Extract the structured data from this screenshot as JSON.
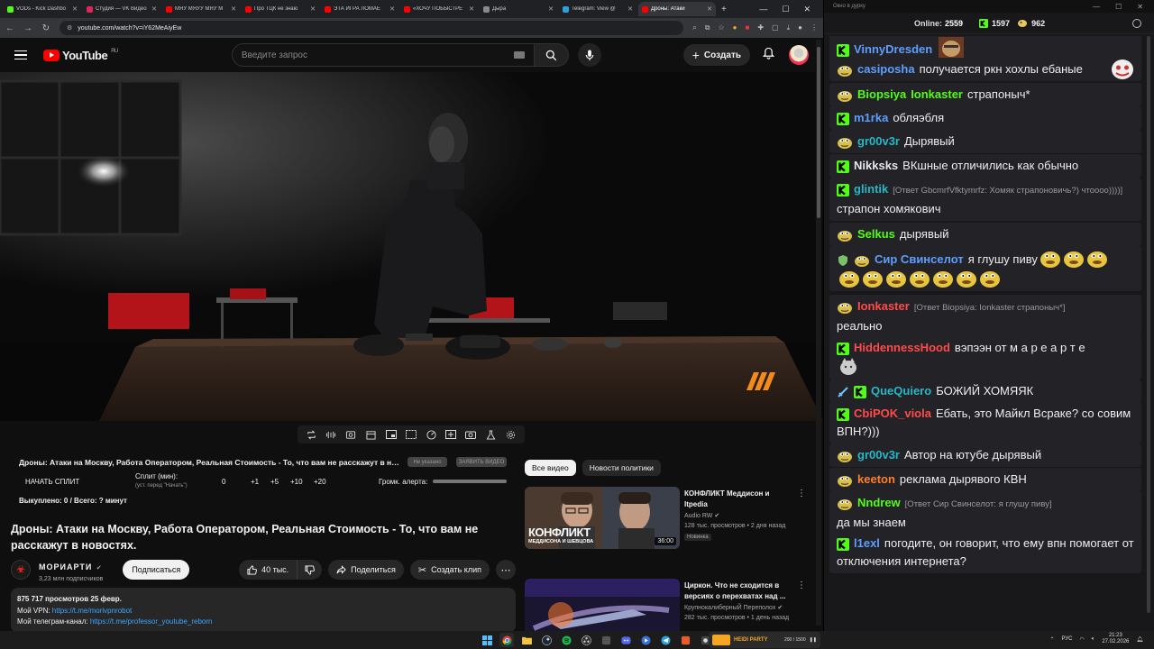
{
  "browser": {
    "tabs": [
      {
        "label": "VODs - Kick Dashbo",
        "color": "#53fc18"
      },
      {
        "label": "Студия — VK Видео",
        "color": "#e0245e"
      },
      {
        "label": "МЯУ МЯУУ МЯУ М",
        "color": "#ff0000"
      },
      {
        "label": "Про ТЦК не знаю",
        "color": "#ff0000"
      },
      {
        "label": "ЭТА ИГРА ЛОМАЕ",
        "color": "#ff0000"
      },
      {
        "label": "«ХОЧУ ПОБЫСТРЕ",
        "color": "#ff0000"
      },
      {
        "label": "Дыра",
        "color": "#888888"
      },
      {
        "label": "Telegram: View @",
        "color": "#2aa1da"
      },
      {
        "label": "Дроны: Атаки",
        "color": "#ff0000"
      }
    ],
    "url": "youtube.com/watch?v=iY62MeAiyEw"
  },
  "youtube": {
    "logo_text": "YouTube",
    "logo_region": "RU",
    "search_placeholder": "Введите запрос",
    "create_label": "Создать"
  },
  "split": {
    "title": "Дроны: Атаки на Москву, Работа Оператором, Реальная Стоимость - То, что вам не расскажут в нов...",
    "pill1": "Не указано",
    "pill2": "ЗАЯВИТЬ ВИДЕО",
    "start_label": "НАЧАТЬ СПЛИТ",
    "split_label": "Сплит (мин):",
    "split_sub": "(уст. перед \"Начать\")",
    "options": [
      "0",
      "+1",
      "+5",
      "+10",
      "+20"
    ],
    "alert_label": "Громк. алерта:",
    "status": "Выкуплено: 0 / Всего: ? минут"
  },
  "video": {
    "title": "Дроны: Атаки на Москву, Работа Оператором, Реальная Стоимость - То, что вам не расскажут в новостях.",
    "channel_name": "МОРИАРТИ",
    "channel_subs": "3,23 млн подписчиков",
    "subscribe_label": "Подписаться",
    "likes": "40 тыс.",
    "share_label": "Поделиться",
    "clip_label": "Создать клип",
    "description": {
      "stats": "875 717 просмотров  25 февр.",
      "vpn_label": "Мой VPN: ",
      "vpn_link": "https://t.me/morivpnrobot",
      "tg_label": "Мой телеграм-канал: ",
      "tg_link": "https://t.me/professor_youtube_reborn"
    }
  },
  "sidebar": {
    "chips": [
      "Все видео",
      "Новости политики"
    ],
    "recs": [
      {
        "title": "КОНФЛИКТ Меддисон и Itpedia",
        "channel": "Audio RW",
        "meta": "128 тыс. просмотров • 2 дня назад",
        "badge": "Новинка",
        "duration": "36:00",
        "thumb_title": "КОНФЛИКТ",
        "thumb_sub": "МЕДДИСОНА И ШЕВЦОВА"
      },
      {
        "title": "Циркон. Что не сходится в версиях о перехватах над ...",
        "channel": "КрупнокалиберныЙ Переполох",
        "meta": "282 тыс. просмотров • 1 день назад"
      }
    ]
  },
  "chat": {
    "window_title": "Окно в дурку",
    "online_label": "Online:",
    "online_count": "2559",
    "kick_count": "1597",
    "other_count": "962",
    "messages": [
      {
        "platform": "kick",
        "user": "VinnyDresden",
        "color": "#5e9eff",
        "text": ""
      },
      {
        "platform": "twitch",
        "user": "casiposha",
        "color": "#5e9eff",
        "text": "получается ркн хохлы ебаные"
      },
      {
        "platform": "twitch",
        "user": "Biopsiya",
        "color": "#53fc18",
        "reply": "Ionkaster",
        "text": "страпоныч*"
      },
      {
        "platform": "kick",
        "user": "m1rka",
        "color": "#5e9eff",
        "text": "обляэбля"
      },
      {
        "platform": "twitch",
        "user": "gr00v3r",
        "color": "#29b6c6",
        "text": "Дырявый"
      },
      {
        "platform": "kick",
        "user": "Nikksks",
        "color": "#e8e8e8",
        "text": "ВКшные отличились как обычно"
      },
      {
        "platform": "kick",
        "user": "glintik",
        "color": "#29b6c6",
        "reply": "[Ответ GbcmrfVfktymrfz: Хомяк страпоновичь?) чтоооо))))]",
        "text": "страпон хомякович"
      },
      {
        "platform": "twitch",
        "user": "Selkus",
        "color": "#53fc18",
        "text": "дырявый"
      },
      {
        "platform": "twitch",
        "user": "Сир Свинселот",
        "color": "#5e9eff",
        "text": "я глушу пиву"
      },
      {
        "platform": "twitch",
        "user": "Ionkaster",
        "color": "#ff4a4a",
        "reply": "[Ответ Biopsiya: Ionkaster страпоныч*]",
        "text": "реально"
      },
      {
        "platform": "kick",
        "user": "HiddennessHood",
        "color": "#ff4a4a",
        "text": "вэпээн от м а р е а р т е"
      },
      {
        "platform": "kick",
        "user": "QueQuiero",
        "color": "#29b6c6",
        "text": "БОЖИЙ ХОМЯЯК"
      },
      {
        "platform": "kick",
        "user": "CbiPOK_viola",
        "color": "#ff4a4a",
        "text": "Ебать, это Майкл Всраке? со совим ВПН?)))"
      },
      {
        "platform": "twitch",
        "user": "gr00v3r",
        "color": "#29b6c6",
        "text": "Автор на ютубе дырявый"
      },
      {
        "platform": "twitch",
        "user": "keeton",
        "color": "#ff7f2a",
        "text": "реклама дырявого КВН"
      },
      {
        "platform": "twitch",
        "user": "Nndrew",
        "color": "#53fc18",
        "reply": "[Ответ Сир Свинселот: я глушу пиву]",
        "text": "да мы знаем"
      },
      {
        "platform": "kick",
        "user": "l1exl",
        "color": "#5e9eff",
        "text": "погодите, он говорит, что ему впн помогает от отключения интернета?"
      }
    ]
  },
  "taskbar": {
    "lang": "РУС",
    "time": "21:23",
    "date": "27.02.2026",
    "media_text": "HEIDI PARTY",
    "media_count": "200 / 1500"
  }
}
